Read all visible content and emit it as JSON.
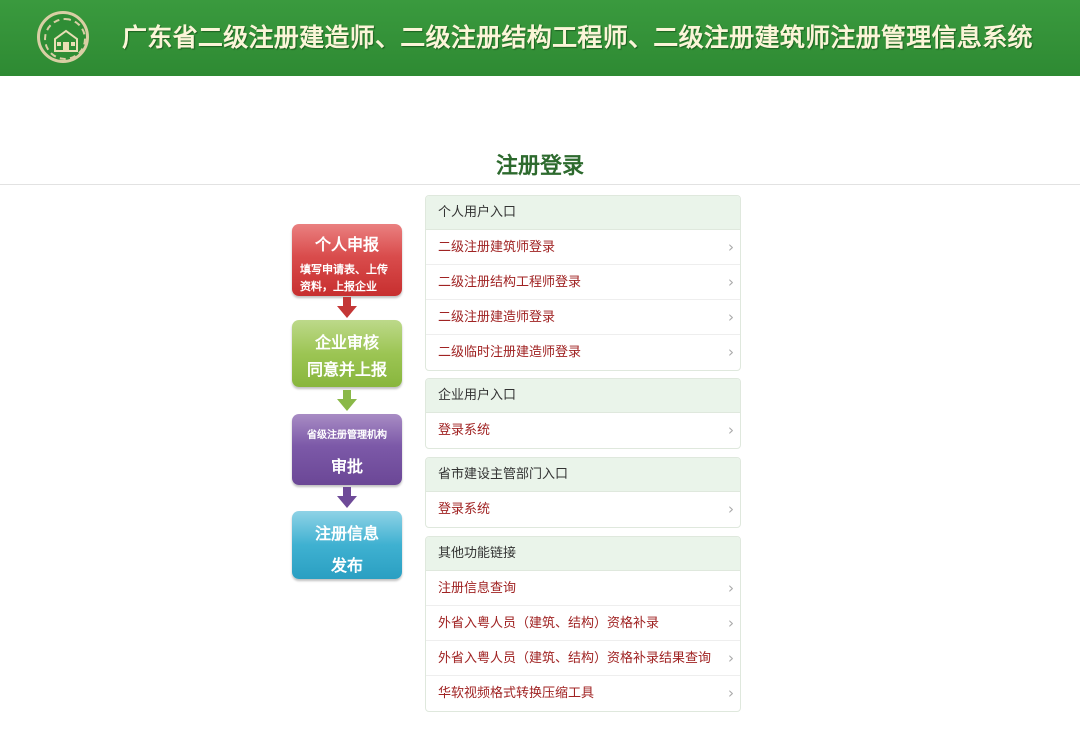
{
  "header": {
    "title": "广东省二级注册建造师、二级注册结构工程师、二级注册建筑师注册管理信息系统"
  },
  "page": {
    "title": "注册登录"
  },
  "flow": {
    "step1": {
      "title": "个人申报",
      "desc": "填写申请表、上传资料，上报企业"
    },
    "step2": {
      "title": "企业审核",
      "desc": "同意并上报"
    },
    "step3": {
      "title": "省级注册管理机构",
      "desc": "审批"
    },
    "step4": {
      "title": "注册信息",
      "desc": "发布"
    }
  },
  "panels": [
    {
      "title": "个人用户入口",
      "items": [
        "二级注册建筑师登录",
        "二级注册结构工程师登录",
        "二级注册建造师登录",
        "二级临时注册建造师登录"
      ]
    },
    {
      "title": "企业用户入口",
      "items": [
        "登录系统"
      ]
    },
    {
      "title": "省市建设主管部门入口",
      "items": [
        "登录系统"
      ]
    },
    {
      "title": "其他功能链接",
      "items": [
        "注册信息查询",
        "外省入粤人员（建筑、结构）资格补录",
        "外省入粤人员（建筑、结构）资格补录结果查询",
        "华软视频格式转换压缩工具"
      ]
    }
  ],
  "icons": {
    "chevron": "chevron-right-icon",
    "arrow": "arrow-down-icon"
  },
  "colors": {
    "header_green": "#2e8a33",
    "link_red": "#a02323",
    "step1": "#d94c4c",
    "step2": "#9cc554",
    "step3": "#7c59a8",
    "step4": "#3fb1d1"
  }
}
